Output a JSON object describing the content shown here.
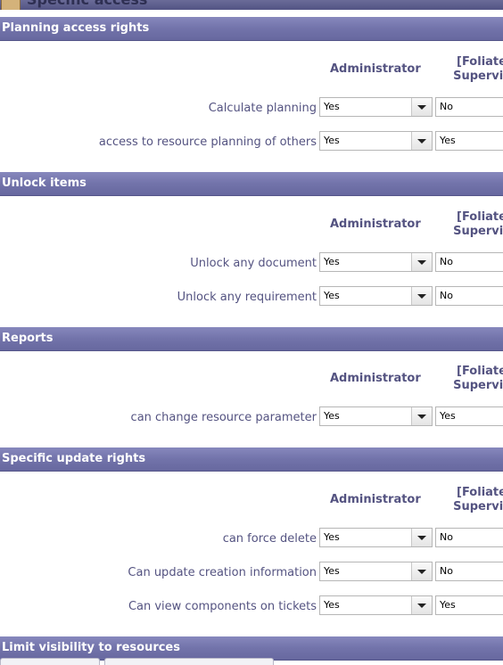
{
  "page": {
    "title": "Specific access"
  },
  "sections": [
    {
      "title": "Planning access rights",
      "col_admin": "Administrator",
      "col_foliate_1": "[Foliate",
      "col_foliate_2": "Supervis",
      "rows": [
        {
          "label": "Calculate planning",
          "admin_value": "Yes",
          "second_value": "No"
        },
        {
          "label": "access to resource planning of others",
          "admin_value": "Yes",
          "second_value": "Yes"
        }
      ]
    },
    {
      "title": "Unlock items",
      "col_admin": "Administrator",
      "col_foliate_1": "[Foliate",
      "col_foliate_2": "Supervis",
      "rows": [
        {
          "label": "Unlock any document",
          "admin_value": "Yes",
          "second_value": "No"
        },
        {
          "label": "Unlock any requirement",
          "admin_value": "Yes",
          "second_value": "No"
        }
      ]
    },
    {
      "title": "Reports",
      "col_admin": "Administrator",
      "col_foliate_1": "[Foliate",
      "col_foliate_2": "Supervis",
      "rows": [
        {
          "label": "can change resource parameter",
          "admin_value": "Yes",
          "second_value": "Yes"
        }
      ]
    },
    {
      "title": "Specific update rights",
      "col_admin": "Administrator",
      "col_foliate_1": "[Foliate",
      "col_foliate_2": "Supervis",
      "rows": [
        {
          "label": "can force delete",
          "admin_value": "Yes",
          "second_value": "No"
        },
        {
          "label": "Can update creation information",
          "admin_value": "Yes",
          "second_value": "No"
        },
        {
          "label": "Can view components on tickets",
          "admin_value": "Yes",
          "second_value": "Yes"
        }
      ]
    },
    {
      "title": "Limit visibility to resources"
    }
  ],
  "icons": {
    "title_icon": "folder-key-icon",
    "dropdown_icon": "chevron-down-icon"
  },
  "colors": {
    "header_top": "#8788bd",
    "header_bottom": "#67689f",
    "label_text": "#545381"
  }
}
